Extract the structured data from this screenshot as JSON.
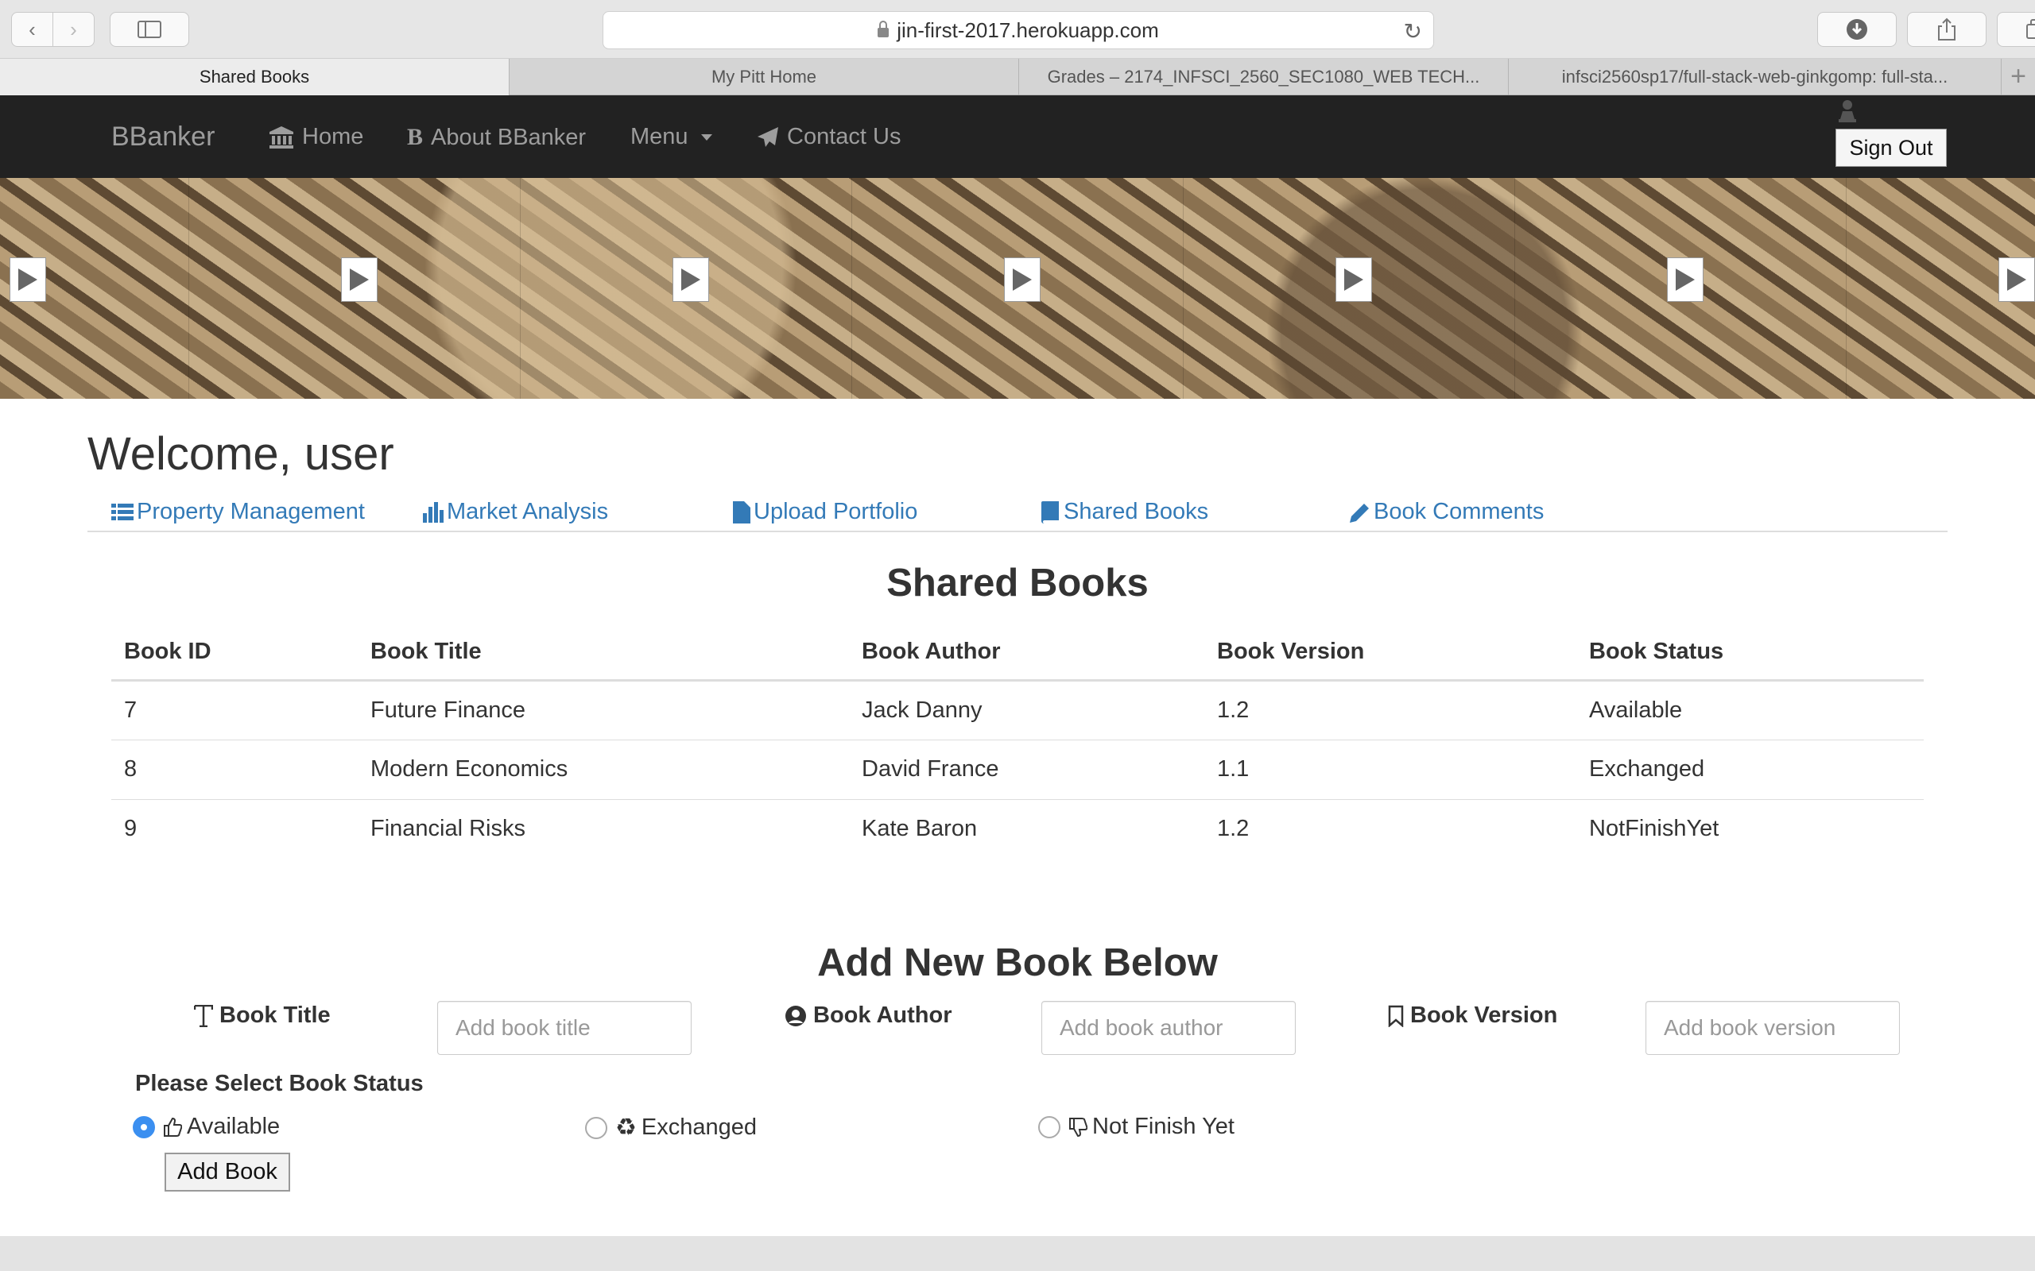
{
  "browser": {
    "url": "jin-first-2017.herokuapp.com",
    "tabs": [
      {
        "label": "Shared Books"
      },
      {
        "label": "My Pitt Home"
      },
      {
        "label": "Grades – 2174_INFSCI_2560_SEC1080_WEB TECH..."
      },
      {
        "label": "infsci2560sp17/full-stack-web-ginkgomp: full-sta..."
      }
    ],
    "new_tab": "+"
  },
  "navbar": {
    "brand": "BBanker",
    "home": "Home",
    "about": "About BBanker",
    "menu": "Menu",
    "contact": "Contact Us",
    "signout": "Sign Out"
  },
  "welcome": "Welcome, user",
  "subnav": {
    "property": "Property Management",
    "market": "Market Analysis",
    "upload": "Upload Portfolio",
    "shared": "Shared Books",
    "comments": "Book Comments"
  },
  "shared_books": {
    "title": "Shared Books",
    "headers": [
      "Book ID",
      "Book Title",
      "Book Author",
      "Book Version",
      "Book Status"
    ],
    "rows": [
      [
        "7",
        "Future Finance",
        "Jack Danny",
        "1.2",
        "Available"
      ],
      [
        "8",
        "Modern Economics",
        "David France",
        "1.1",
        "Exchanged"
      ],
      [
        "9",
        "Financial Risks",
        "Kate Baron",
        "1.2",
        "NotFinishYet"
      ]
    ]
  },
  "add_book": {
    "title": "Add New Book Below",
    "title_label": "Book Title",
    "title_placeholder": "Add book title",
    "author_label": "Book Author",
    "author_placeholder": "Add book author",
    "version_label": "Book Version",
    "version_placeholder": "Add book version",
    "status_label": "Please Select Book Status",
    "status_options": [
      "Available",
      "Exchanged",
      "Not Finish Yet"
    ],
    "selected_status": "Available",
    "submit": "Add Book"
  },
  "colors": {
    "navbar_bg": "#222222",
    "link": "#337ab7",
    "radio_selected": "#3b8ff0"
  }
}
